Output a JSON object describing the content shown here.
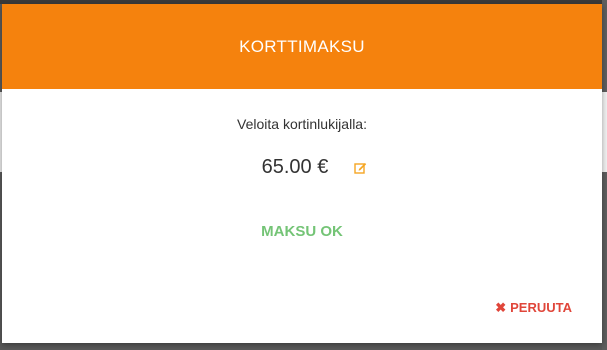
{
  "modal": {
    "title": "KORTTIMAKSU",
    "prompt": "Veloita kortinlukijalla:",
    "amount": "65.00 €",
    "edit_icon": "edit-icon",
    "ok_label": "MAKSU OK",
    "cancel_label": "PERUUTA",
    "cancel_icon": "close-icon"
  },
  "colors": {
    "header": "#f5820d",
    "ok": "#74c476",
    "cancel": "#e0463a",
    "edit_icon": "#f5a623"
  }
}
